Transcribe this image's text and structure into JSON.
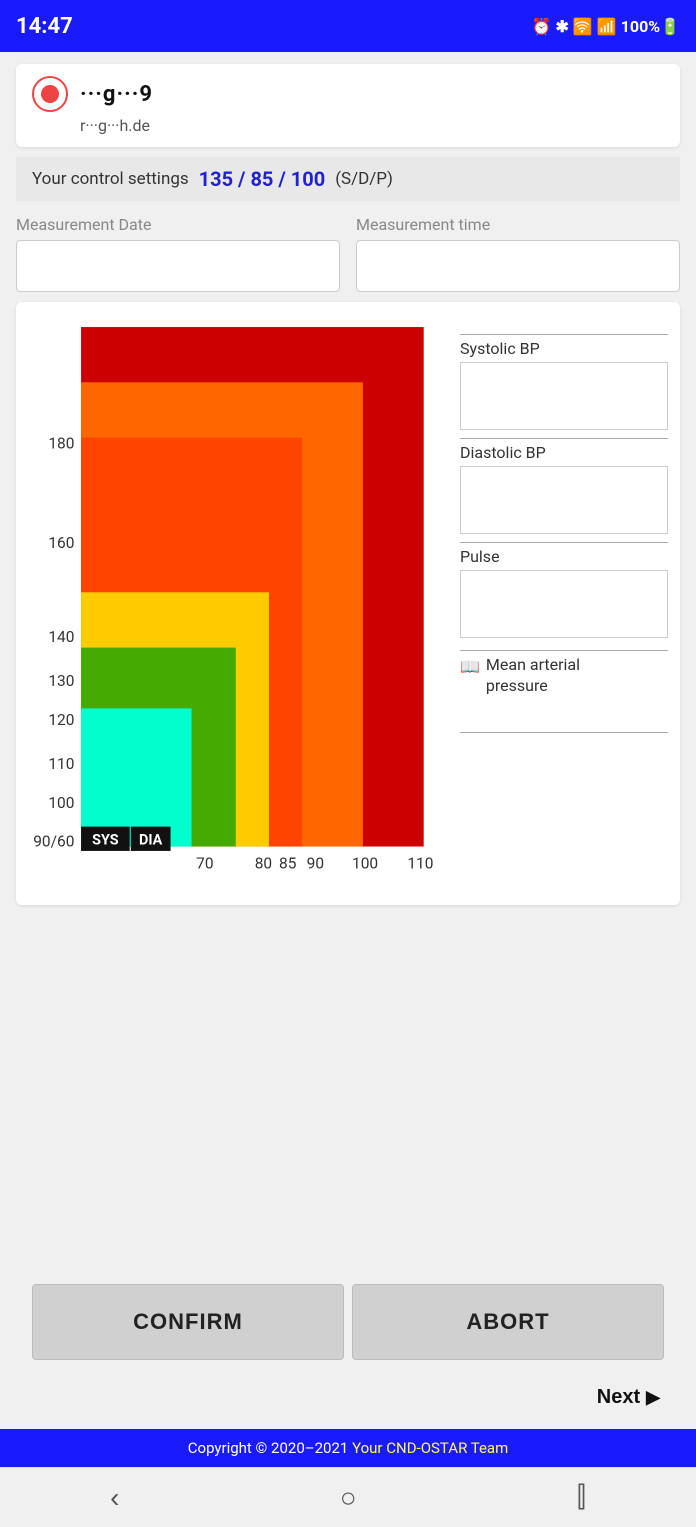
{
  "statusBar": {
    "time": "14:47",
    "icons": "⏰ ✱ 🛜 📶 100%🔋"
  },
  "profile": {
    "name": "···g···9",
    "email": "r···g···h.de",
    "iconColor": "#ee4444"
  },
  "controlSettings": {
    "label": "Your control settings",
    "values": "135 / 85 / 100",
    "unit": "(S/D/P)"
  },
  "measurementDate": {
    "label": "Measurement Date",
    "placeholder": ""
  },
  "measurementTime": {
    "label": "Measurement time",
    "placeholder": ""
  },
  "chart": {
    "yLabels": [
      "90/60",
      "100",
      "110",
      "120",
      "130",
      "140",
      "160",
      "180"
    ],
    "xLabels": [
      "DIA",
      "70",
      "80",
      "85",
      "90",
      "100",
      "110"
    ],
    "sysLabel": "SYS"
  },
  "bpInputs": {
    "systolicLabel": "Systolic BP",
    "diastolicLabel": "Diastolic BP",
    "pulseLabel": "Pulse",
    "mapLabel": "Mean arterial\npressure"
  },
  "buttons": {
    "confirm": "CONFIRM",
    "abort": "ABORT",
    "next": "Next"
  },
  "footer": {
    "copyright": "Copyright © 2020–2021",
    "team": "Your CND-OSTAR Team"
  },
  "nav": {
    "back": "‹",
    "home": "○",
    "recent": "⫿"
  }
}
